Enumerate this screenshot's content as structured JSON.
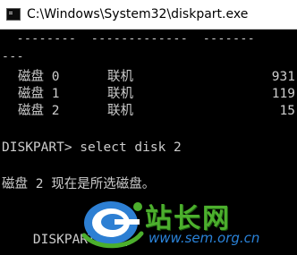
{
  "window": {
    "title": "C:\\Windows\\System32\\diskpart.exe"
  },
  "console": {
    "header_dashes": "  --------  -------------  -------",
    "header_dashes_wrap": "---",
    "disks": [
      {
        "name": "磁盘 0",
        "status": "联机",
        "size": "931"
      },
      {
        "name": "磁盘 1",
        "status": "联机",
        "size": "119"
      },
      {
        "name": "磁盘 2",
        "status": "联机",
        "size": "15"
      }
    ],
    "command_line": "DISKPART> select disk 2",
    "result_message": "磁盘 2 现在是所选磁盘。",
    "prompt_line": "DISKPART> c"
  },
  "watermark": {
    "brand": "站长网",
    "url": "www.sem.org.cn"
  }
}
